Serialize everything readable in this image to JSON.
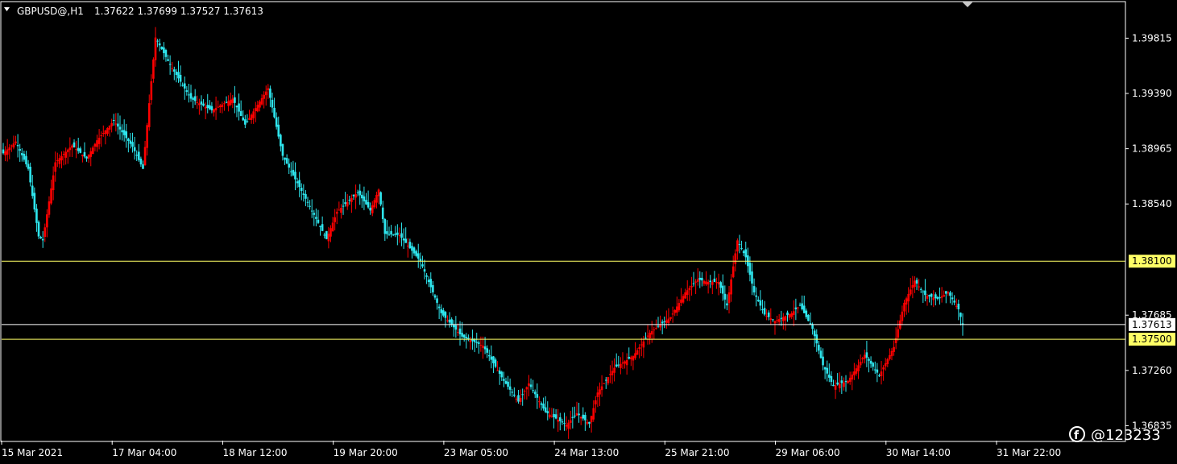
{
  "header": {
    "symbol": "GBPUSD@,H1",
    "ohlc": "1.37622 1.37699 1.37527 1.37613"
  },
  "watermark": {
    "text": "@123233",
    "icon": "logo-f-icon"
  },
  "colors": {
    "background": "#000000",
    "frame": "#ffffff",
    "bull_candle": "#ff0000",
    "bear_candle": "#2ee6ee",
    "level_line": "#ffff66",
    "price_line": "#ffffff"
  },
  "chart_data": {
    "type": "candlestick",
    "title": "GBPUSD@,H1",
    "ylim": [
      1.3672,
      1.4009
    ],
    "y_ticks": [
      "1.39815",
      "1.39390",
      "1.38965",
      "1.38540",
      "1.37685",
      "1.37260",
      "1.36835"
    ],
    "x_ticks": [
      "15 Mar 2021",
      "17 Mar 04:00",
      "18 Mar 12:00",
      "19 Mar 20:00",
      "23 Mar 05:00",
      "24 Mar 13:00",
      "25 Mar 21:00",
      "29 Mar 06:00",
      "30 Mar 14:00",
      "31 Mar 22:00"
    ],
    "levels": [
      {
        "label": "1.38100",
        "value": 1.381,
        "style": "highlight"
      },
      {
        "label": "1.37613",
        "value": 1.37613,
        "style": "current"
      },
      {
        "label": "1.37500",
        "value": 1.375,
        "style": "highlight"
      }
    ],
    "last_bar": {
      "open": 1.37622,
      "high": 1.37699,
      "low": 1.37527,
      "close": 1.37613
    },
    "close_path": [
      [
        0,
        1.3893
      ],
      [
        6,
        1.3902
      ],
      [
        12,
        1.3881
      ],
      [
        17,
        1.3829
      ],
      [
        19,
        1.3826
      ],
      [
        25,
        1.3886
      ],
      [
        33,
        1.3899
      ],
      [
        40,
        1.3889
      ],
      [
        45,
        1.3903
      ],
      [
        53,
        1.3918
      ],
      [
        62,
        1.3898
      ],
      [
        67,
        1.3881
      ],
      [
        73,
        1.3982
      ],
      [
        80,
        1.3961
      ],
      [
        90,
        1.3935
      ],
      [
        100,
        1.3926
      ],
      [
        110,
        1.3935
      ],
      [
        116,
        1.3915
      ],
      [
        127,
        1.3943
      ],
      [
        134,
        1.3891
      ],
      [
        145,
        1.3858
      ],
      [
        155,
        1.3827
      ],
      [
        160,
        1.3848
      ],
      [
        170,
        1.3863
      ],
      [
        176,
        1.3849
      ],
      [
        180,
        1.3865
      ],
      [
        183,
        1.3831
      ],
      [
        190,
        1.383
      ],
      [
        200,
        1.381
      ],
      [
        210,
        1.377
      ],
      [
        220,
        1.3752
      ],
      [
        230,
        1.3745
      ],
      [
        240,
        1.3718
      ],
      [
        247,
        1.3702
      ],
      [
        252,
        1.3716
      ],
      [
        260,
        1.3694
      ],
      [
        270,
        1.3684
      ],
      [
        275,
        1.3693
      ],
      [
        281,
        1.3685
      ],
      [
        285,
        1.3709
      ],
      [
        293,
        1.3728
      ],
      [
        302,
        1.3737
      ],
      [
        310,
        1.3755
      ],
      [
        320,
        1.3767
      ],
      [
        327,
        1.3786
      ],
      [
        333,
        1.3796
      ],
      [
        338,
        1.3794
      ],
      [
        343,
        1.3794
      ],
      [
        347,
        1.3776
      ],
      [
        352,
        1.3826
      ],
      [
        356,
        1.3813
      ],
      [
        360,
        1.3786
      ],
      [
        365,
        1.3769
      ],
      [
        370,
        1.3764
      ],
      [
        378,
        1.377
      ],
      [
        382,
        1.3776
      ],
      [
        388,
        1.3758
      ],
      [
        393,
        1.373
      ],
      [
        398,
        1.3714
      ],
      [
        405,
        1.3718
      ],
      [
        410,
        1.373
      ],
      [
        413,
        1.3738
      ],
      [
        420,
        1.3722
      ],
      [
        427,
        1.3744
      ],
      [
        432,
        1.3778
      ],
      [
        437,
        1.3795
      ],
      [
        442,
        1.3784
      ],
      [
        448,
        1.3781
      ],
      [
        453,
        1.3786
      ],
      [
        458,
        1.3773
      ],
      [
        460,
        1.37613
      ]
    ]
  }
}
